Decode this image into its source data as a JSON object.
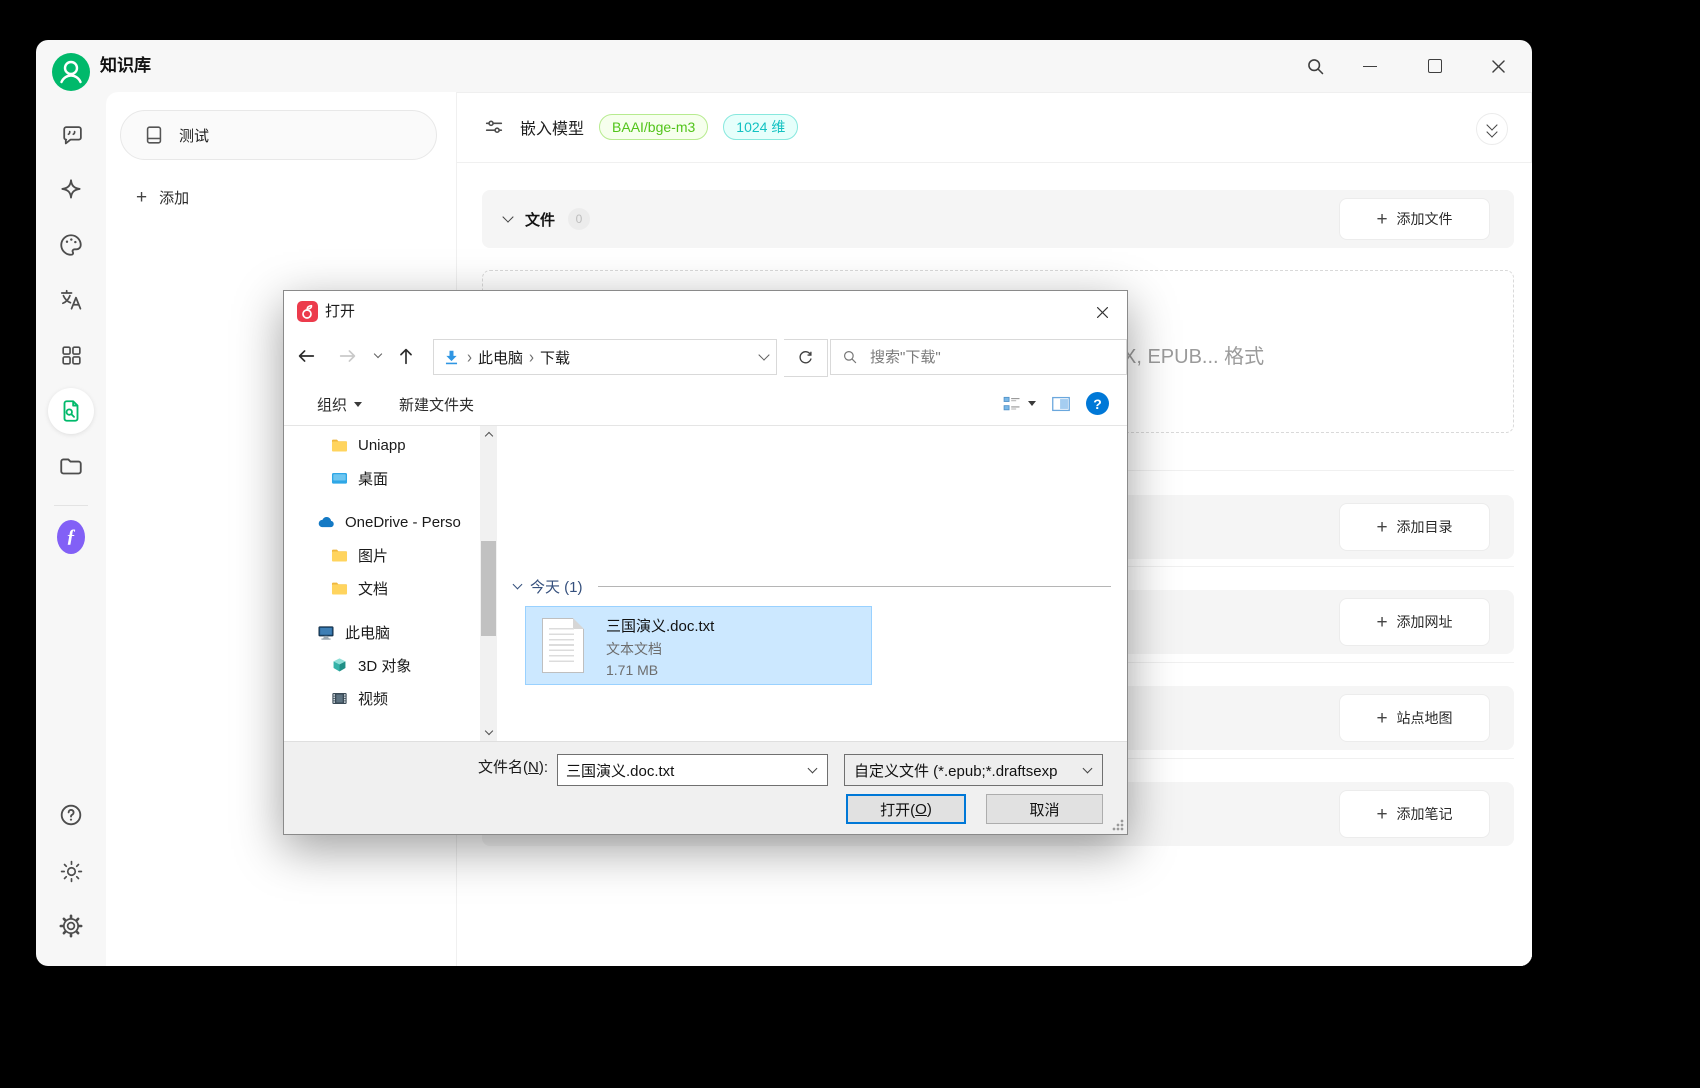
{
  "app": {
    "title": "知识库"
  },
  "kb_panel": {
    "item_label": "测试",
    "add_label": "添加"
  },
  "kb_header": {
    "embed_label": "嵌入模型",
    "model_badge": "BAAI/bge-m3",
    "dim_badge": "1024 维"
  },
  "kb_sections": {
    "files_title": "文件",
    "files_count": "0",
    "add_file": "添加文件",
    "drop_hint_fragment": "X, EPUB... 格式",
    "extra": [
      {
        "label": "添加目录"
      },
      {
        "label": "添加网址"
      },
      {
        "label": "站点地图"
      },
      {
        "label": "添加笔记"
      }
    ]
  },
  "dialog": {
    "title": "打开",
    "breadcrumb": {
      "root": "此电脑",
      "leaf": "下载"
    },
    "search_placeholder": "搜索\"下载\"",
    "toolbar": {
      "organize": "组织",
      "new_folder": "新建文件夹"
    },
    "tree": [
      {
        "label": "Uniapp",
        "icon": "folder-icon"
      },
      {
        "label": "桌面",
        "icon": "desktop-icon"
      },
      {
        "label": "OneDrive - Perso",
        "icon": "onedrive-icon"
      },
      {
        "label": "图片",
        "icon": "folder-icon"
      },
      {
        "label": "文档",
        "icon": "folder-icon"
      },
      {
        "label": "此电脑",
        "icon": "computer-icon"
      },
      {
        "label": "3D 对象",
        "icon": "cube-icon"
      },
      {
        "label": "视频",
        "icon": "film-icon"
      }
    ],
    "group_header": "今天 (1)",
    "file": {
      "name": "三国演义.doc.txt",
      "type": "文本文档",
      "size": "1.71 MB"
    },
    "footer": {
      "filename_label_pre": "文件名(",
      "filename_access_key": "N",
      "filename_label_post": "):",
      "filename_value": "三国演义.doc.txt",
      "filetype_value": "自定义文件 (*.epub;*.draftsexp",
      "open_pre": "打开(",
      "open_key": "O",
      "open_post": ")",
      "cancel": "取消"
    }
  },
  "colors": {
    "accent_green": "#00b96b",
    "badge_green_text": "#52c41a",
    "badge_cyan_text": "#13c2c2",
    "win_blue": "#0078d7",
    "selection_bg": "#cce8ff",
    "selection_border": "#99d1ff"
  }
}
